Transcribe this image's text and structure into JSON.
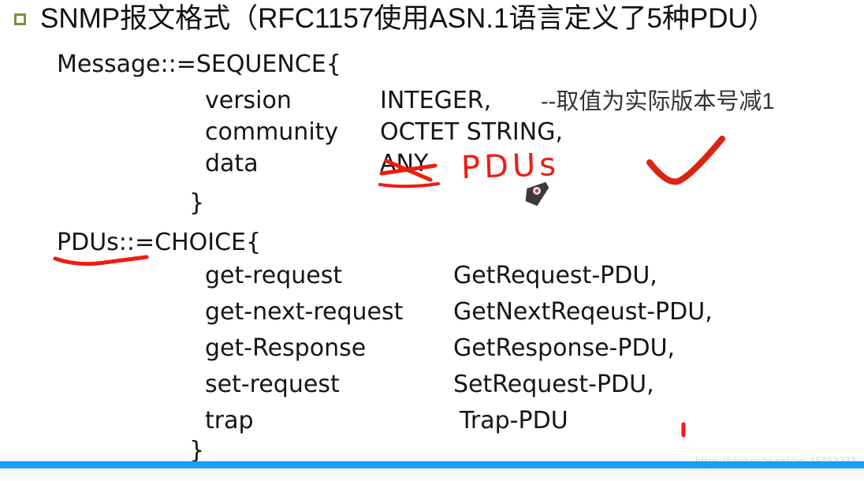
{
  "slide": {
    "title": "SNMP报文格式（RFC1157使用ASN.1语言定义了5种PDU）",
    "bullet_color": "#8a8a42",
    "accent_bar_color": "#15a0fb",
    "ink_color": "#ee1c10",
    "background": "#ffffff"
  },
  "message_block": {
    "header": "Message::=SEQUENCE{",
    "fields": [
      {
        "name": "version",
        "type": "INTEGER,",
        "comment": "--取值为实际版本号减1"
      },
      {
        "name": "community",
        "type": "OCTET STRING,",
        "comment": ""
      },
      {
        "name": "data",
        "type": "ANY",
        "comment": ""
      }
    ],
    "closing_brace": "}"
  },
  "pdus_block": {
    "header": "PDUs::=CHOICE{",
    "entries": [
      {
        "name": "get-request",
        "type": "GetRequest-PDU,"
      },
      {
        "name": "get-next-request",
        "type": "GetNextReqeust-PDU,"
      },
      {
        "name": "get-Response",
        "type": "GetResponse-PDU,"
      },
      {
        "name": "set-request",
        "type": "SetRequest-PDU,"
      },
      {
        "name": "trap",
        "type": "Trap-PDU"
      }
    ],
    "closing_brace": "}"
  },
  "annotations": {
    "handwritten_pdus": "PDUs",
    "strike_target": "ANY",
    "checkmark": "red-checkmark",
    "underline_target": "PDUs",
    "red_dot": "red-tick-mark"
  },
  "cursor": {
    "type": "pen-cursor"
  },
  "watermark": {
    "text": "https://blog.csdn.net/qq_45452273"
  }
}
